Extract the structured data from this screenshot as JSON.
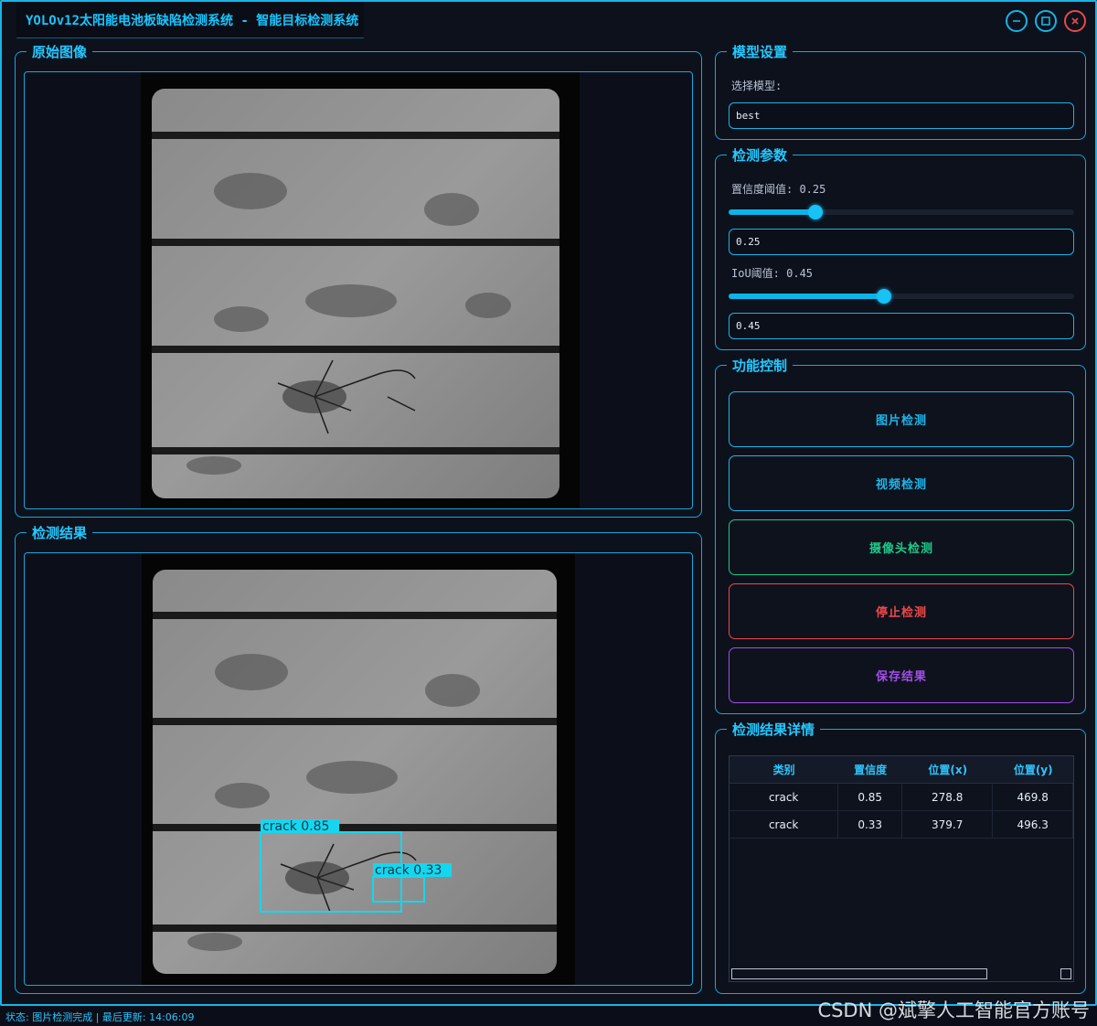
{
  "window": {
    "title": "YOLOv12太阳能电池板缺陷检测系统 - 智能目标检测系统"
  },
  "panels": {
    "original_title": "原始图像",
    "result_title": "检测结果"
  },
  "detections_overlay": [
    {
      "label": "crack 0.85"
    },
    {
      "label": "crack 0.33"
    }
  ],
  "model_settings": {
    "title": "模型设置",
    "select_label": "选择模型:",
    "selected_model": "best"
  },
  "params": {
    "title": "检测参数",
    "confidence_label": "置信度阈值: 0.25",
    "confidence_value": "0.25",
    "confidence_fraction": 0.25,
    "iou_label": "IoU阈值: 0.45",
    "iou_value": "0.45",
    "iou_fraction": 0.45
  },
  "controls": {
    "title": "功能控制",
    "image_detect": "图片检测",
    "video_detect": "视频检测",
    "camera_detect": "摄像头检测",
    "stop_detect": "停止检测",
    "save_results": "保存结果",
    "colors": {
      "image": "#1fb6ea",
      "video": "#1fb6ea",
      "camera": "#1ec98a",
      "stop": "#ee4a4a",
      "save": "#a24ee8"
    }
  },
  "results": {
    "title": "检测结果详情",
    "headers": [
      "类别",
      "置信度",
      "位置(x)",
      "位置(y)"
    ],
    "rows": [
      [
        "crack",
        "0.85",
        "278.8",
        "469.8"
      ],
      [
        "crack",
        "0.33",
        "379.7",
        "496.3"
      ]
    ]
  },
  "status": {
    "text": "状态: 图片检测完成 | 最后更新: 14:06:09"
  },
  "watermark": "CSDN @斌擎人工智能官方账号"
}
